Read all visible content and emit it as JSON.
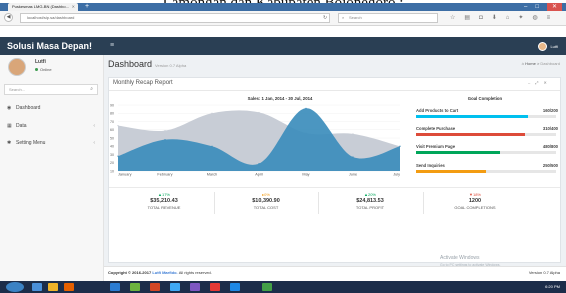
{
  "caption": "Lamongan dan Kabupaten Bojonegoro :",
  "browser": {
    "tab_title": "Puskesmas LMG-BN (Dashbo...",
    "tab_close": "✕",
    "new_tab": "+",
    "url": "localhost/sip.sa/dashboard",
    "search_placeholder": "Search",
    "window_controls": [
      "–",
      "□",
      "✕"
    ]
  },
  "app": {
    "brand": "Solusi Masa Depan!",
    "menu_toggle": "≡",
    "header_user": "Lutfi"
  },
  "sidebar": {
    "user_name": "Lutfi",
    "user_status": "Online",
    "search_placeholder": "Search...",
    "items": [
      {
        "label": "Dashboard",
        "icon": "dashboard-icon",
        "glyph": "◉"
      },
      {
        "label": "Data",
        "icon": "table-icon",
        "glyph": "▦"
      },
      {
        "label": "Setting Menu",
        "icon": "settings-icon",
        "glyph": "✱"
      }
    ]
  },
  "page": {
    "title": "Dashboard",
    "version_tag": "Version 0.7 Alpha",
    "breadcrumb_home": "Home",
    "breadcrumb_sep": ">",
    "breadcrumb_current": "Dashboard"
  },
  "box": {
    "title": "Monthly Recap Report",
    "tools": [
      "–",
      "⤢",
      "✕"
    ]
  },
  "chart_data": {
    "type": "area",
    "title": "Sales: 1 Jan, 2014 - 30 Jul, 2014",
    "categories": [
      "January",
      "February",
      "March",
      "April",
      "May",
      "June",
      "July"
    ],
    "ylim": [
      10,
      90
    ],
    "yticks": [
      10,
      20,
      30,
      40,
      50,
      60,
      70,
      80,
      90
    ],
    "series": [
      {
        "color": "#c8cdd6",
        "values": [
          65,
          59,
          80,
          81,
          56,
          55,
          40
        ]
      },
      {
        "color": "#3c8dbc",
        "values": [
          28,
          48,
          40,
          19,
          86,
          27,
          40
        ]
      }
    ]
  },
  "goals": {
    "title": "Goal Completion",
    "items": [
      {
        "label": "Add Products to Cart",
        "value": "160/200",
        "fraction": 0.8,
        "color": "#00c0ef"
      },
      {
        "label": "Complete Purchase",
        "value": "310/400",
        "fraction": 0.78,
        "color": "#dd4b39"
      },
      {
        "label": "Visit Premium Page",
        "value": "480/800",
        "fraction": 0.6,
        "color": "#00a65a"
      },
      {
        "label": "Send Inquiries",
        "value": "250/500",
        "fraction": 0.5,
        "color": "#f39c12"
      }
    ]
  },
  "stats": [
    {
      "pct": "▲17%",
      "pct_color": "#00a65a",
      "value": "$35,210.43",
      "label": "TOTAL REVENUE"
    },
    {
      "pct": "▸0%",
      "pct_color": "#f39c12",
      "value": "$10,390.90",
      "label": "TOTAL COST"
    },
    {
      "pct": "▲20%",
      "pct_color": "#00a65a",
      "value": "$24,813.53",
      "label": "TOTAL PROFIT"
    },
    {
      "pct": "▼18%",
      "pct_color": "#dd4b39",
      "value": "1200",
      "label": "GOAL COMPLETIONS"
    }
  ],
  "footer": {
    "copyright_prefix": "Copyright © 2016-2017",
    "copyright_link": "Lutfi Marfido.",
    "copyright_suffix": "All rights reserved.",
    "version": "Version 0.7 Alpha"
  },
  "watermark": {
    "title": "Activate Windows",
    "sub": "Go to PC settings to activate Windows."
  },
  "taskbar": {
    "clock": "6:20 PM"
  }
}
